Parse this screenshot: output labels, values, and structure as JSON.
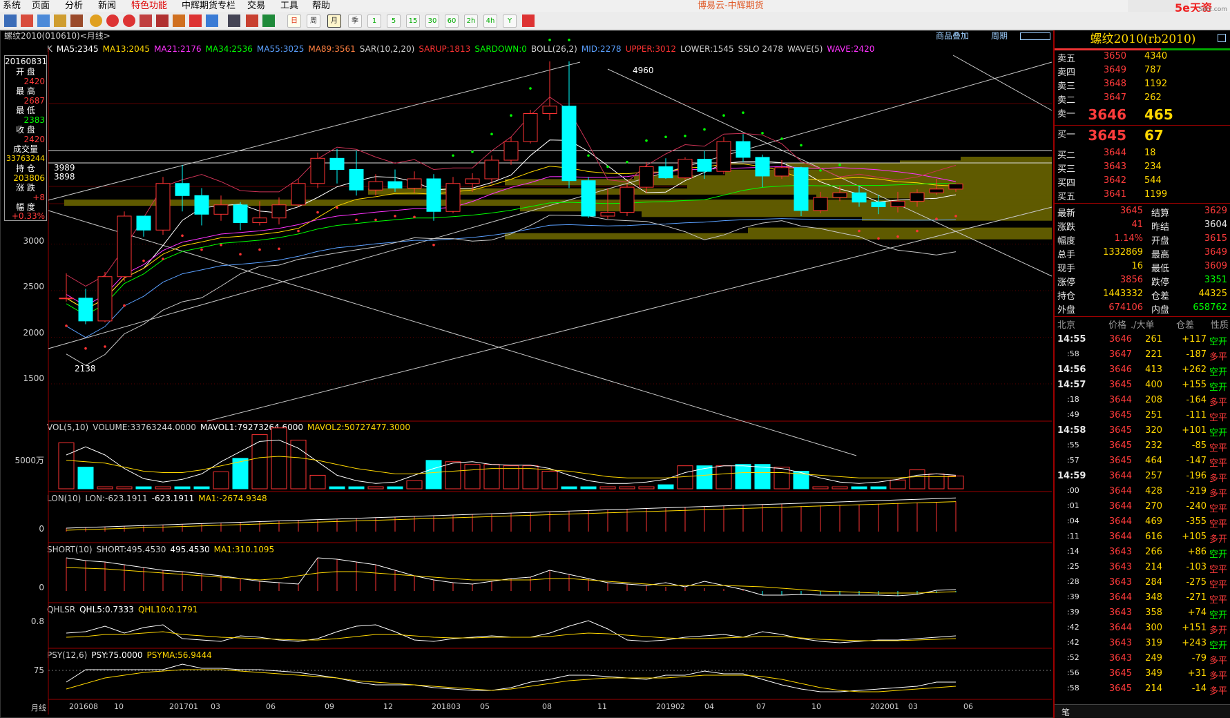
{
  "menu": [
    "系统",
    "页面",
    "分析",
    "新闻",
    "特色功能",
    "中辉期货专栏",
    "交易",
    "工具",
    "帮助"
  ],
  "app_title": "博易云-中辉期货",
  "brand": "5e天资",
  "brand_sub": "Setz.com",
  "toolbar_period_labels": [
    "日",
    "周",
    "月",
    "季",
    "1",
    "5",
    "15",
    "30",
    "60",
    "2h",
    "4h",
    "Y"
  ],
  "stock_title": "螺纹2010(010610)<月线>",
  "top_links": {
    "overlay": "商品叠加",
    "period": "周期"
  },
  "left": {
    "date": "20160831",
    "labels": [
      "开 盘",
      "最 高",
      "最 低",
      "收 盘",
      "成交量",
      "持 仓",
      "涨 跌",
      "幅 度"
    ],
    "values": [
      "2420",
      "2687",
      "2383",
      "2420",
      "33763244",
      "203806",
      "+8",
      "+0.33%"
    ]
  },
  "ma_line": [
    {
      "t": "K",
      "c": "#d0d0d0"
    },
    {
      "t": "MA5:2345",
      "c": "#ffffff"
    },
    {
      "t": "MA13:2045",
      "c": "#ffd700"
    },
    {
      "t": "MA21:2176",
      "c": "#ff33ff"
    },
    {
      "t": "MA34:2536",
      "c": "#00ff00"
    },
    {
      "t": "MA55:3025",
      "c": "#5aa0ff"
    },
    {
      "t": "MA89:3561",
      "c": "#ff8040"
    },
    {
      "t": "SAR(10,2,20)",
      "c": "#d0d0d0"
    },
    {
      "t": "SARUP:1813",
      "c": "#ff3333"
    },
    {
      "t": "SARDOWN:0",
      "c": "#00ff00"
    },
    {
      "t": "BOLL(26,2)",
      "c": "#d0d0d0"
    },
    {
      "t": "MID:2278",
      "c": "#5aa0ff"
    },
    {
      "t": "UPPER:3012",
      "c": "#ff3333"
    },
    {
      "t": "LOWER:1545",
      "c": "#d0d0d0"
    },
    {
      "t": "SSLO 2478",
      "c": "#d0d0d0"
    },
    {
      "t": "WAVE(5)",
      "c": "#d0d0d0"
    },
    {
      "t": "WAVE:2420",
      "c": "#ff33ff"
    }
  ],
  "price_labels": {
    "high": "4960",
    "low": "2138",
    "box1": "3989",
    "box2": "3898"
  },
  "yaxis_main": [
    "3000",
    "2500",
    "2000",
    "1500"
  ],
  "vol_title": [
    {
      "t": "VOL(5,10)",
      "c": "#d0d0d0"
    },
    {
      "t": "VOLUME:33763244.0000",
      "c": "#d0d0d0"
    },
    {
      "t": "MAVOL1:79273264.6000",
      "c": "#ffffff"
    },
    {
      "t": "MAVOL2:50727477.3000",
      "c": "#ffd700"
    }
  ],
  "vol_axis": "5000万",
  "lon_title": [
    {
      "t": "LON(10)",
      "c": "#d0d0d0"
    },
    {
      "t": "LON:-623.1911",
      "c": "#d0d0d0"
    },
    {
      "t": "-623.1911",
      "c": "#ffffff"
    },
    {
      "t": "MA1:-2674.9348",
      "c": "#ffd700"
    }
  ],
  "lon_axis": "0",
  "short_title": [
    {
      "t": "SHORT(10)",
      "c": "#d0d0d0"
    },
    {
      "t": "SHORT:495.4530",
      "c": "#d0d0d0"
    },
    {
      "t": "495.4530",
      "c": "#ffffff"
    },
    {
      "t": "MA1:310.1095",
      "c": "#ffd700"
    }
  ],
  "short_axis": "0",
  "qhl_title": [
    {
      "t": "QHLSR",
      "c": "#d0d0d0"
    },
    {
      "t": "QHL5:0.7333",
      "c": "#ffffff"
    },
    {
      "t": "QHL10:0.1791",
      "c": "#ffd700"
    }
  ],
  "qhl_axis": "0.8",
  "psy_title": [
    {
      "t": "PSY(12,6)",
      "c": "#d0d0d0"
    },
    {
      "t": "PSY:75.0000",
      "c": "#ffffff"
    },
    {
      "t": "PSYMA:56.9444",
      "c": "#ffd700"
    }
  ],
  "psy_axis": "75",
  "xaxis": [
    "月线",
    "201608",
    "10",
    "201701",
    "03",
    "06",
    "09",
    "12",
    "201803",
    "05",
    "08",
    "11",
    "201902",
    "04",
    "07",
    "10",
    "202001",
    "03",
    "06"
  ],
  "right": {
    "title": "螺纹2010(rb2010)",
    "asks": [
      {
        "l": "卖五",
        "p": "3650",
        "v": "4340"
      },
      {
        "l": "卖四",
        "p": "3649",
        "v": "787"
      },
      {
        "l": "卖三",
        "p": "3648",
        "v": "1192"
      },
      {
        "l": "卖二",
        "p": "3647",
        "v": "262"
      },
      {
        "l": "卖一",
        "p": "3646",
        "v": "465"
      }
    ],
    "bids": [
      {
        "l": "买一",
        "p": "3645",
        "v": "67"
      },
      {
        "l": "买二",
        "p": "3644",
        "v": "18"
      },
      {
        "l": "买三",
        "p": "3643",
        "v": "234"
      },
      {
        "l": "买四",
        "p": "3642",
        "v": "544"
      },
      {
        "l": "买五",
        "p": "3641",
        "v": "1199"
      }
    ],
    "stats": [
      {
        "l1": "最新",
        "v1": "3645",
        "c1": "red",
        "l2": "结算",
        "v2": "3629",
        "c2": "red"
      },
      {
        "l1": "涨跌",
        "v1": "41",
        "c1": "red",
        "l2": "昨结",
        "v2": "3604",
        "c2": "wht"
      },
      {
        "l1": "幅度",
        "v1": "1.14%",
        "c1": "red",
        "l2": "开盘",
        "v2": "3615",
        "c2": "red"
      },
      {
        "l1": "总手",
        "v1": "1332869",
        "c1": "yel",
        "l2": "最高",
        "v2": "3649",
        "c2": "red"
      },
      {
        "l1": "现手",
        "v1": "16",
        "c1": "yel",
        "l2": "最低",
        "v2": "3609",
        "c2": "red"
      },
      {
        "l1": "涨停",
        "v1": "3856",
        "c1": "red",
        "l2": "跌停",
        "v2": "3351",
        "c2": "grn"
      },
      {
        "l1": "持仓",
        "v1": "1443332",
        "c1": "yel",
        "l2": "仓差",
        "v2": "44325",
        "c2": "yel"
      },
      {
        "l1": "外盘",
        "v1": "674106",
        "c1": "red",
        "l2": "内盘",
        "v2": "658762",
        "c2": "grn"
      }
    ],
    "tick_header": [
      "北京",
      "价格",
      "./大单",
      "仓差",
      "性质"
    ],
    "ticks": [
      {
        "t": "14:55",
        "p": "3646",
        "v": "261",
        "d": "+117",
        "n": "空开",
        "nc": "grn"
      },
      {
        "t": ":58",
        "p": "3647",
        "v": "221",
        "d": "-187",
        "n": "多平",
        "nc": "red"
      },
      {
        "t": "14:56",
        "p": "3646",
        "v": "413",
        "d": "+262",
        "n": "空开",
        "nc": "grn"
      },
      {
        "t": "14:57",
        "p": "3645",
        "v": "400",
        "d": "+155",
        "n": "空开",
        "nc": "grn"
      },
      {
        "t": ":18",
        "p": "3644",
        "v": "208",
        "d": "-164",
        "n": "多平",
        "nc": "red"
      },
      {
        "t": ":49",
        "p": "3645",
        "v": "251",
        "d": "-111",
        "n": "空平",
        "nc": "red"
      },
      {
        "t": "14:58",
        "p": "3645",
        "v": "320",
        "d": "+101",
        "n": "空开",
        "nc": "grn"
      },
      {
        "t": ":55",
        "p": "3645",
        "v": "232",
        "d": "-85",
        "n": "空平",
        "nc": "red"
      },
      {
        "t": ":57",
        "p": "3645",
        "v": "464",
        "d": "-147",
        "n": "空平",
        "nc": "red"
      },
      {
        "t": "14:59",
        "p": "3644",
        "v": "257",
        "d": "-196",
        "n": "多平",
        "nc": "red"
      },
      {
        "t": ":00",
        "p": "3644",
        "v": "428",
        "d": "-219",
        "n": "多平",
        "nc": "red"
      },
      {
        "t": ":01",
        "p": "3644",
        "v": "270",
        "d": "-240",
        "n": "空平",
        "nc": "red"
      },
      {
        "t": ":04",
        "p": "3644",
        "v": "469",
        "d": "-355",
        "n": "空平",
        "nc": "red"
      },
      {
        "t": ":11",
        "p": "3644",
        "v": "616",
        "d": "+105",
        "n": "多开",
        "nc": "red"
      },
      {
        "t": ":14",
        "p": "3643",
        "v": "266",
        "d": "+86",
        "n": "空开",
        "nc": "grn"
      },
      {
        "t": ":25",
        "p": "3643",
        "v": "214",
        "d": "-103",
        "n": "空平",
        "nc": "red"
      },
      {
        "t": ":28",
        "p": "3643",
        "v": "284",
        "d": "-275",
        "n": "空平",
        "nc": "red"
      },
      {
        "t": ":39",
        "p": "3644",
        "v": "348",
        "d": "-271",
        "n": "空平",
        "nc": "red"
      },
      {
        "t": ":39",
        "p": "3643",
        "v": "358",
        "d": "+74",
        "n": "空开",
        "nc": "grn"
      },
      {
        "t": ":42",
        "p": "3644",
        "v": "300",
        "d": "+151",
        "n": "多开",
        "nc": "red"
      },
      {
        "t": ":42",
        "p": "3643",
        "v": "319",
        "d": "+243",
        "n": "空开",
        "nc": "grn"
      },
      {
        "t": ":52",
        "p": "3643",
        "v": "249",
        "d": "-79",
        "n": "多平",
        "nc": "red"
      },
      {
        "t": ":56",
        "p": "3645",
        "v": "349",
        "d": "+31",
        "n": "多平",
        "nc": "red"
      },
      {
        "t": ":58",
        "p": "3645",
        "v": "214",
        "d": "-14",
        "n": "多平",
        "nc": "red"
      }
    ],
    "footer": "笔"
  },
  "chart_data": {
    "type": "candlestick",
    "title": "螺纹2010(010610)<月线>",
    "period": "月线",
    "x": [
      "201608",
      "201609",
      "201610",
      "201611",
      "201612",
      "201701",
      "201702",
      "201703",
      "201704",
      "201705",
      "201706",
      "201707",
      "201708",
      "201709",
      "201710",
      "201711",
      "201712",
      "201801",
      "201802",
      "201803",
      "201804",
      "201805",
      "201806",
      "201807",
      "201808",
      "201809",
      "201810",
      "201811",
      "201812",
      "201901",
      "201902",
      "201903",
      "201904",
      "201905",
      "201906",
      "201907",
      "201908",
      "201909",
      "201910",
      "201911",
      "201912",
      "202001",
      "202002",
      "202003",
      "202004",
      "202005",
      "202006"
    ],
    "ohlc": [
      [
        2420,
        2687,
        2383,
        2420
      ],
      [
        2420,
        2520,
        2140,
        2175
      ],
      [
        2175,
        2700,
        2160,
        2650
      ],
      [
        2650,
        3350,
        2600,
        3300
      ],
      [
        3300,
        3280,
        3080,
        3150
      ],
      [
        3150,
        3720,
        3100,
        3650
      ],
      [
        3650,
        3850,
        3350,
        3520
      ],
      [
        3520,
        3600,
        3200,
        3320
      ],
      [
        3320,
        3520,
        3250,
        3420
      ],
      [
        3420,
        3450,
        3150,
        3230
      ],
      [
        3230,
        3460,
        3200,
        3280
      ],
      [
        3280,
        3500,
        3210,
        3420
      ],
      [
        3420,
        3700,
        3400,
        3650
      ],
      [
        3650,
        3980,
        3600,
        3920
      ],
      [
        3920,
        4020,
        3650,
        3800
      ],
      [
        3800,
        4000,
        3520,
        3580
      ],
      [
        3580,
        3750,
        3520,
        3670
      ],
      [
        3670,
        3800,
        3560,
        3600
      ],
      [
        3600,
        3780,
        3550,
        3700
      ],
      [
        3700,
        3750,
        3250,
        3350
      ],
      [
        3350,
        3720,
        3330,
        3650
      ],
      [
        3650,
        3760,
        3560,
        3700
      ],
      [
        3700,
        3950,
        3650,
        3900
      ],
      [
        3900,
        4150,
        3850,
        4100
      ],
      [
        4100,
        4440,
        4080,
        4400
      ],
      [
        4400,
        4960,
        4330,
        4480
      ],
      [
        4480,
        4960,
        3600,
        3680
      ],
      [
        3680,
        3720,
        3280,
        3300
      ],
      [
        3300,
        3600,
        3270,
        3340
      ],
      [
        3340,
        3650,
        3300,
        3610
      ],
      [
        3610,
        3880,
        3550,
        3830
      ],
      [
        3830,
        3920,
        3700,
        3710
      ],
      [
        3710,
        3930,
        3690,
        3910
      ],
      [
        3910,
        4000,
        3700,
        3780
      ],
      [
        3780,
        4150,
        3750,
        4100
      ],
      [
        4100,
        4180,
        3880,
        3930
      ],
      [
        3930,
        3960,
        3610,
        3730
      ],
      [
        3730,
        3900,
        3700,
        3820
      ],
      [
        3820,
        3830,
        3300,
        3360
      ],
      [
        3360,
        3560,
        3330,
        3500
      ],
      [
        3500,
        3620,
        3460,
        3550
      ],
      [
        3550,
        3620,
        3400,
        3450
      ],
      [
        3450,
        3530,
        3320,
        3400
      ],
      [
        3400,
        3560,
        3340,
        3460
      ],
      [
        3460,
        3590,
        3400,
        3550
      ],
      [
        3550,
        3700,
        3530,
        3590
      ],
      [
        3590,
        3646,
        3560,
        3645
      ]
    ],
    "ylim": [
      1100,
      5100
    ],
    "yticks": [
      1500,
      2000,
      2500,
      3000
    ],
    "indicators": {
      "VOL": {
        "VOLUME": 33763244,
        "MAVOL1": 79273264.6,
        "MAVOL2": 50727477.3
      },
      "LON": {
        "LON": -623.1911,
        "MA1": -2674.9348
      },
      "SHORT": {
        "SHORT": 495.453,
        "MA1": 310.1095
      },
      "QHLSR": {
        "QHL5": 0.7333,
        "QHL10": 0.1791
      },
      "PSY": {
        "PSY": 75,
        "PSYMA": 56.9444
      }
    }
  }
}
